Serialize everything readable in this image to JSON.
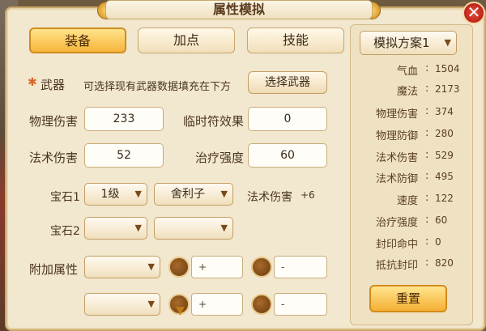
{
  "window": {
    "title": "属性模拟",
    "close": "✕"
  },
  "tabs": [
    "装备",
    "加点",
    "技能"
  ],
  "weapon": {
    "label": "武器",
    "hint": "可选择现有武器数据填充在下方",
    "select_button": "选择武器"
  },
  "fields": {
    "phys_dmg_label": "物理伤害",
    "phys_dmg_value": "233",
    "temp_rune_label": "临时符效果",
    "temp_rune_value": "0",
    "magic_dmg_label": "法术伤害",
    "magic_dmg_value": "52",
    "heal_label": "治疗强度",
    "heal_value": "60"
  },
  "gem1": {
    "label": "宝石1",
    "level": "1级",
    "type": "舍利子",
    "effect_label": "法术伤害",
    "effect_value": "+6"
  },
  "gem2": {
    "label": "宝石2",
    "level": "",
    "type": ""
  },
  "extra": {
    "label": "附加属性",
    "plus": "+",
    "minus": "-"
  },
  "icons": {
    "caret": "chevron-down-icon"
  },
  "scheme": {
    "label": "模拟方案1"
  },
  "stats": [
    {
      "name": "气血",
      "value": "1504"
    },
    {
      "name": "魔法",
      "value": "2173"
    },
    {
      "name": "物理伤害",
      "value": "374"
    },
    {
      "name": "物理防御",
      "value": "280"
    },
    {
      "name": "法术伤害",
      "value": "529"
    },
    {
      "name": "法术防御",
      "value": "495"
    },
    {
      "name": "速度",
      "value": "122"
    },
    {
      "name": "治疗强度",
      "value": "60"
    },
    {
      "name": "封印命中",
      "value": "0"
    },
    {
      "name": "抵抗封印",
      "value": "820"
    }
  ],
  "reset_label": "重置",
  "colors": {
    "accent": "#f6b53b",
    "frame": "#f2e7cf",
    "close": "#c8241a"
  }
}
